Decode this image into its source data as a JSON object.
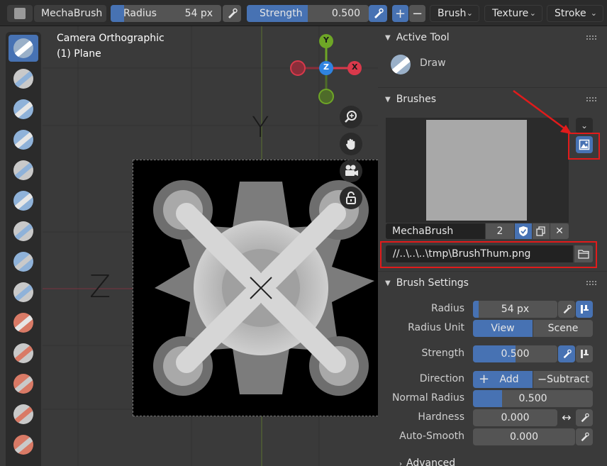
{
  "header": {
    "brush_name": "MechaBrush",
    "radius_label": "Radius",
    "radius_value": "54 px",
    "radius_fill": 0.12,
    "strength_label": "Strength",
    "strength_value": "0.500",
    "plus": "+",
    "minus": "−",
    "menus": [
      "Brush",
      "Texture",
      "Stroke"
    ]
  },
  "viewport": {
    "camera_line": "Camera Orthographic",
    "object_line": "(1) Plane",
    "axis_y": "Y",
    "axis_z": "Z",
    "gizmo": {
      "y": "Y",
      "z": "Z",
      "x": "X"
    }
  },
  "active_tool": {
    "title": "Active Tool",
    "tool_name": "Draw"
  },
  "brushes": {
    "title": "Brushes",
    "brush_name": "MechaBrush",
    "users": "2",
    "icon_path": "//..\\..\\..\\tmp\\BrushThum.png"
  },
  "brush_settings": {
    "title": "Brush Settings",
    "radius_label": "Radius",
    "radius_value": "54 px",
    "radius_fill": 0.07,
    "radius_unit_label": "Radius Unit",
    "unit_view": "View",
    "unit_scene": "Scene",
    "strength_label": "Strength",
    "strength_value": "0.500",
    "strength_fill": 0.5,
    "direction_label": "Direction",
    "direction_add": "Add",
    "direction_subtract": "Subtract",
    "normal_radius_label": "Normal Radius",
    "normal_radius_value": "0.500",
    "normal_radius_fill": 0.25,
    "hardness_label": "Hardness",
    "hardness_value": "0.000",
    "auto_smooth_label": "Auto-Smooth",
    "auto_smooth_value": "0.000",
    "advanced_label": "Advanced"
  },
  "colors": {
    "accent": "#4772b3",
    "highlight": "#e11b1b",
    "gizmo_x": "#d9394b",
    "gizmo_y": "#6ea626",
    "gizmo_z": "#2f83e0"
  }
}
